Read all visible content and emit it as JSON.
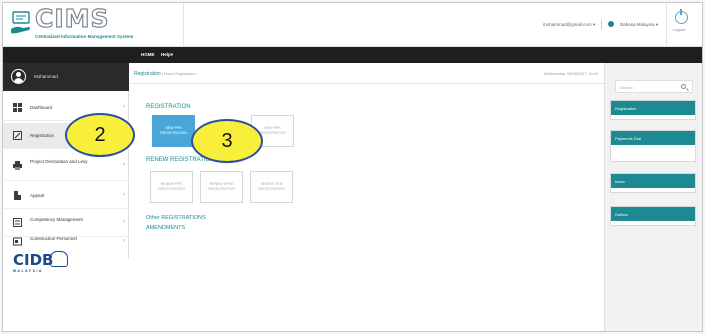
{
  "header": {
    "logo_word": "CIMS",
    "logo_subtitle": "Centralized Information Management System",
    "user_email": "mohammad@gmail.com",
    "language": "Bahasa Malaysia",
    "logout_label": "Logout"
  },
  "topnav": {
    "home": "HOME",
    "help": "Help"
  },
  "sidebar": {
    "user_name": "Mohammad",
    "items": [
      {
        "label": "Dashboard",
        "icon": "dashboard-icon"
      },
      {
        "label": "Registration",
        "icon": "edit-icon"
      },
      {
        "label": "Project Declaration and Levy",
        "icon": "printer-icon"
      },
      {
        "label": "Appeal",
        "icon": "appeal-icon"
      },
      {
        "label": "Competency Management",
        "icon": "document-icon"
      },
      {
        "label": "Construction Personnel",
        "icon": "id-card-icon"
      }
    ],
    "logo_text": "CIDB",
    "logo_sub": "MALAYSIA"
  },
  "main": {
    "page_title": "Registration",
    "breadcrumb": "| Home Registration",
    "date": "Wednesday, 09/08/2017 10:44",
    "registration_title": "REGISTRATION",
    "reg_buttons": [
      {
        "label": "NEW PPK REGISTRATION"
      },
      {
        "label": "NEW PPK REGISTRATION"
      }
    ],
    "renew_title": "RENEW REGISTRATION",
    "renew_buttons": [
      {
        "label": "RENEW PPK REGISTRATION"
      },
      {
        "label": "RENEW SPKK REGISTRATION"
      },
      {
        "label": "RENEW STB REGISTRATION"
      }
    ],
    "other_title": "Other REGISTRATIONS",
    "amendments_title": "AMENDMENTS"
  },
  "rightpanel": {
    "search_placeholder": "Search",
    "cards": [
      "Registration",
      "Payments Due",
      "Inbox",
      "Outbox"
    ]
  },
  "callouts": [
    "2",
    "3"
  ],
  "colors": {
    "teal": "#1d8a93",
    "primary_button": "#4aa6d6",
    "callout_fill": "#f7ef3a",
    "callout_border": "#2a4fa0"
  }
}
